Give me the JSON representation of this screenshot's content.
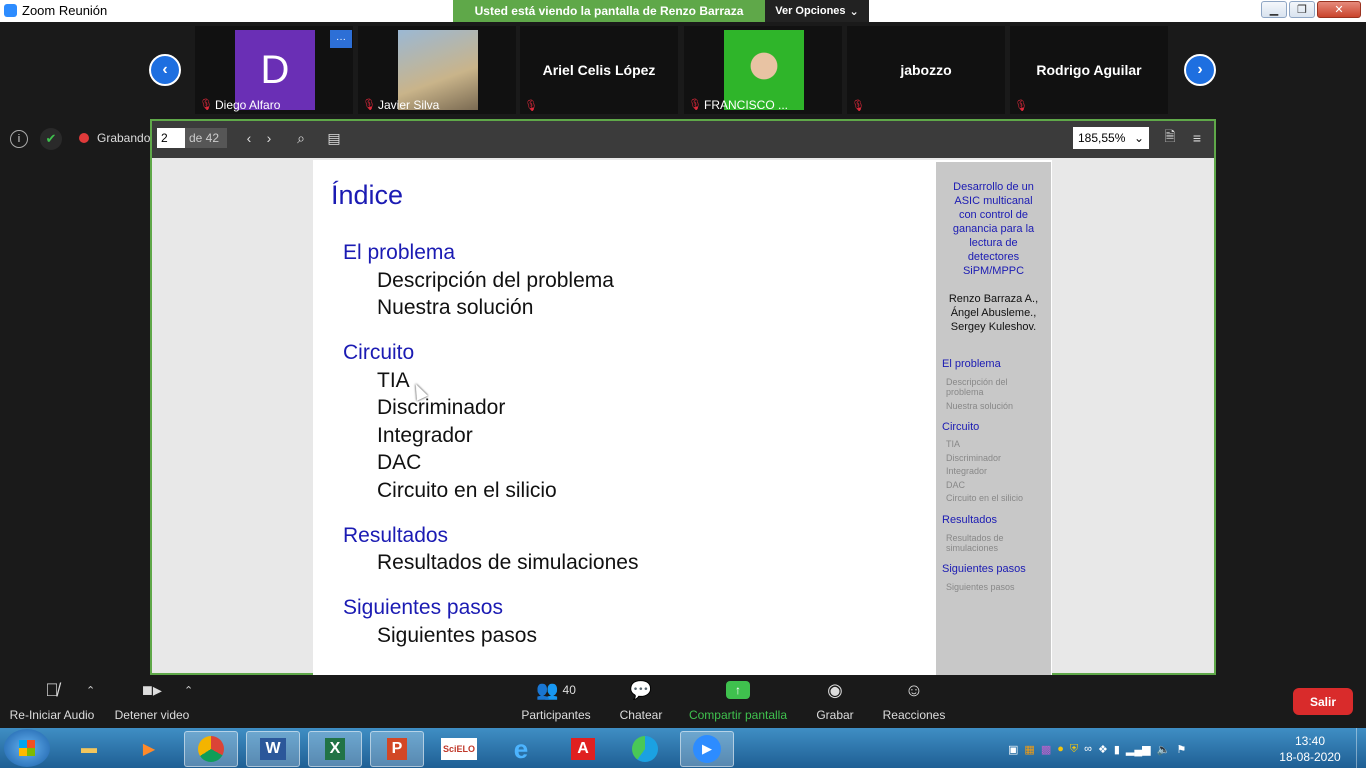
{
  "window": {
    "title": "Zoom Reunión",
    "share_banner": "Usted está viendo la pantalla de Renzo Barraza",
    "view_options": "Ver Opciones"
  },
  "participants": [
    {
      "name": "Diego Alfaro",
      "avatar_letter": "D"
    },
    {
      "name": "Javier Silva"
    },
    {
      "name": "Ariel Celis López"
    },
    {
      "name": "FRANCISCO ..."
    },
    {
      "name": "jabozzo"
    },
    {
      "name": "Rodrigo Aguilar"
    }
  ],
  "status": {
    "recording": "Grabando"
  },
  "pdf_toolbar": {
    "page": "2",
    "of_total": "de 42",
    "zoom": "185,55%"
  },
  "slide": {
    "title": "Índice",
    "sections": [
      {
        "label": "El problema",
        "items": [
          "Descripción del problema",
          "Nuestra solución"
        ]
      },
      {
        "label": "Circuito",
        "items": [
          "TIA",
          "Discriminador",
          "Integrador",
          "DAC",
          "Circuito en el silicio"
        ]
      },
      {
        "label": "Resultados",
        "items": [
          "Resultados de simulaciones"
        ]
      },
      {
        "label": "Siguientes pasos",
        "items": [
          "Siguientes pasos"
        ]
      }
    ],
    "sidebar": {
      "title_lines": [
        "Desarrollo de un",
        "ASIC multicanal",
        "con control de",
        "ganancia para la",
        "lectura de",
        "detectores",
        "SiPM/MPPC"
      ],
      "author_lines": [
        "Renzo Barraza A.,",
        "Ángel Abusleme.,",
        "Sergey Kuleshov."
      ],
      "sections": [
        {
          "label": "El problema",
          "items": [
            "Descripción del",
            "problema",
            "Nuestra solución"
          ]
        },
        {
          "label": "Circuito",
          "items": [
            "TIA",
            "Discriminador",
            "Integrador",
            "DAC",
            "Circuito en el silicio"
          ]
        },
        {
          "label": "Resultados",
          "items": [
            "Resultados de",
            "simulaciones"
          ]
        },
        {
          "label": "Siguientes pasos",
          "items": [
            "Siguientes pasos"
          ]
        }
      ]
    }
  },
  "controls": {
    "audio": "Re-Iniciar Audio",
    "video": "Detener video",
    "participants": "Participantes",
    "participants_count": "40",
    "chat": "Chatear",
    "share": "Compartir pantalla",
    "record": "Grabar",
    "reactions": "Reacciones",
    "leave": "Salir"
  },
  "taskbar": {
    "time": "13:40",
    "date": "18-08-2020",
    "scielo": "SciELO"
  },
  "colors": {
    "accent_green": "#5fa849",
    "beamer_blue": "#1b1bb3",
    "leave_red": "#d92b2b",
    "zoom_blue": "#1e6fe0"
  }
}
